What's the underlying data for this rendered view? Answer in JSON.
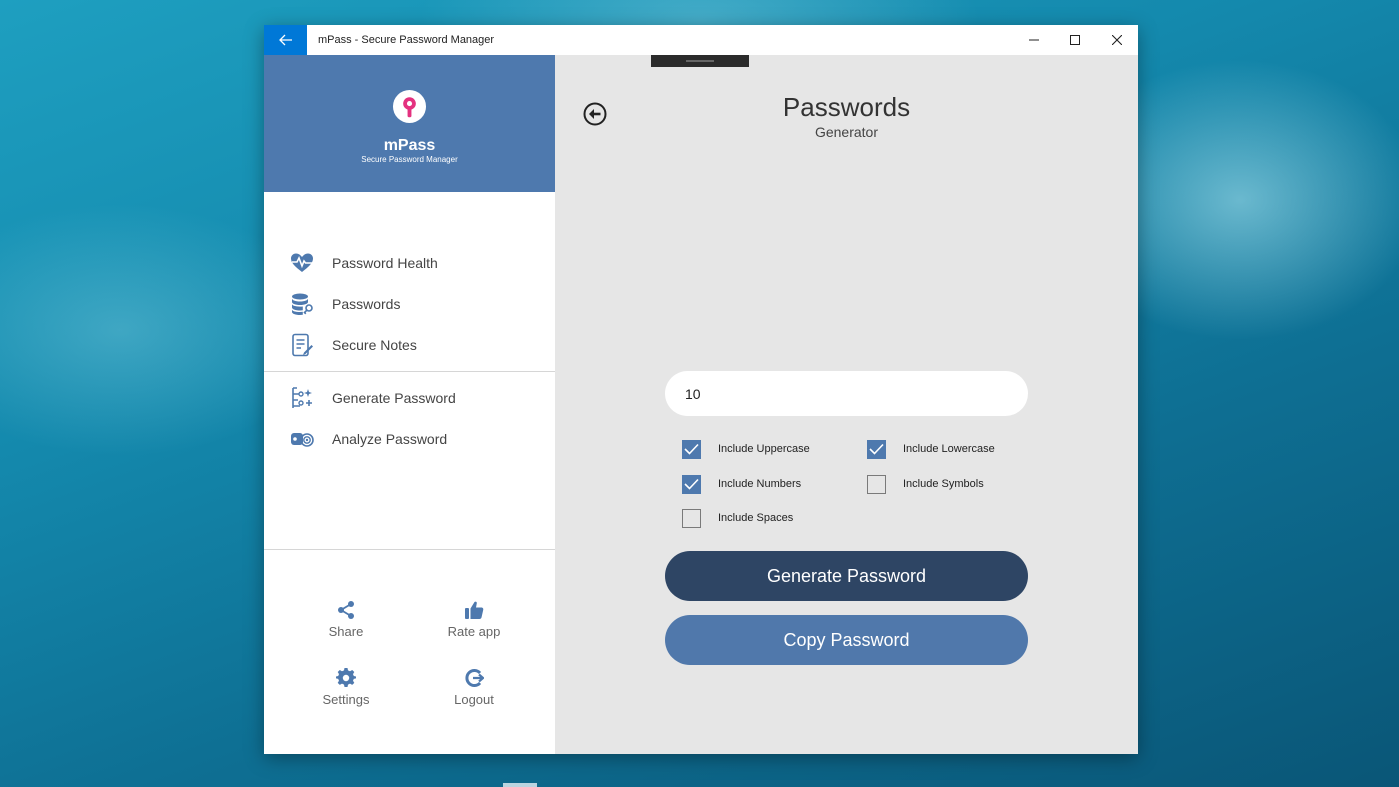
{
  "window": {
    "title": "mPass - Secure Password Manager"
  },
  "brand": {
    "name": "mPass",
    "tagline": "Secure Password Manager"
  },
  "sidebar": {
    "items": [
      {
        "label": "Password Health",
        "icon": "heart-pulse-icon"
      },
      {
        "label": "Passwords",
        "icon": "database-key-icon"
      },
      {
        "label": "Secure Notes",
        "icon": "note-edit-icon"
      },
      {
        "label": "Generate Password",
        "icon": "generate-sparkle-icon"
      },
      {
        "label": "Analyze Password",
        "icon": "analyze-key-icon"
      }
    ],
    "footer": [
      {
        "label": "Share",
        "icon": "share-icon"
      },
      {
        "label": "Rate app",
        "icon": "thumbs-up-icon"
      },
      {
        "label": "Settings",
        "icon": "gear-icon"
      },
      {
        "label": "Logout",
        "icon": "logout-icon"
      }
    ]
  },
  "main": {
    "title": "Passwords",
    "subtitle": "Generator",
    "length_value": "10",
    "options": [
      {
        "label": "Include Uppercase",
        "checked": true
      },
      {
        "label": "Include Lowercase",
        "checked": true
      },
      {
        "label": "Include Numbers",
        "checked": true
      },
      {
        "label": "Include Symbols",
        "checked": false
      },
      {
        "label": "Include Spaces",
        "checked": false
      }
    ],
    "generate_label": "Generate Password",
    "copy_label": "Copy Password"
  },
  "colors": {
    "accent": "#4e79ae",
    "dark_button": "#2e4564",
    "titlebar_accent": "#0078d7",
    "logo_pink": "#e4317f"
  }
}
